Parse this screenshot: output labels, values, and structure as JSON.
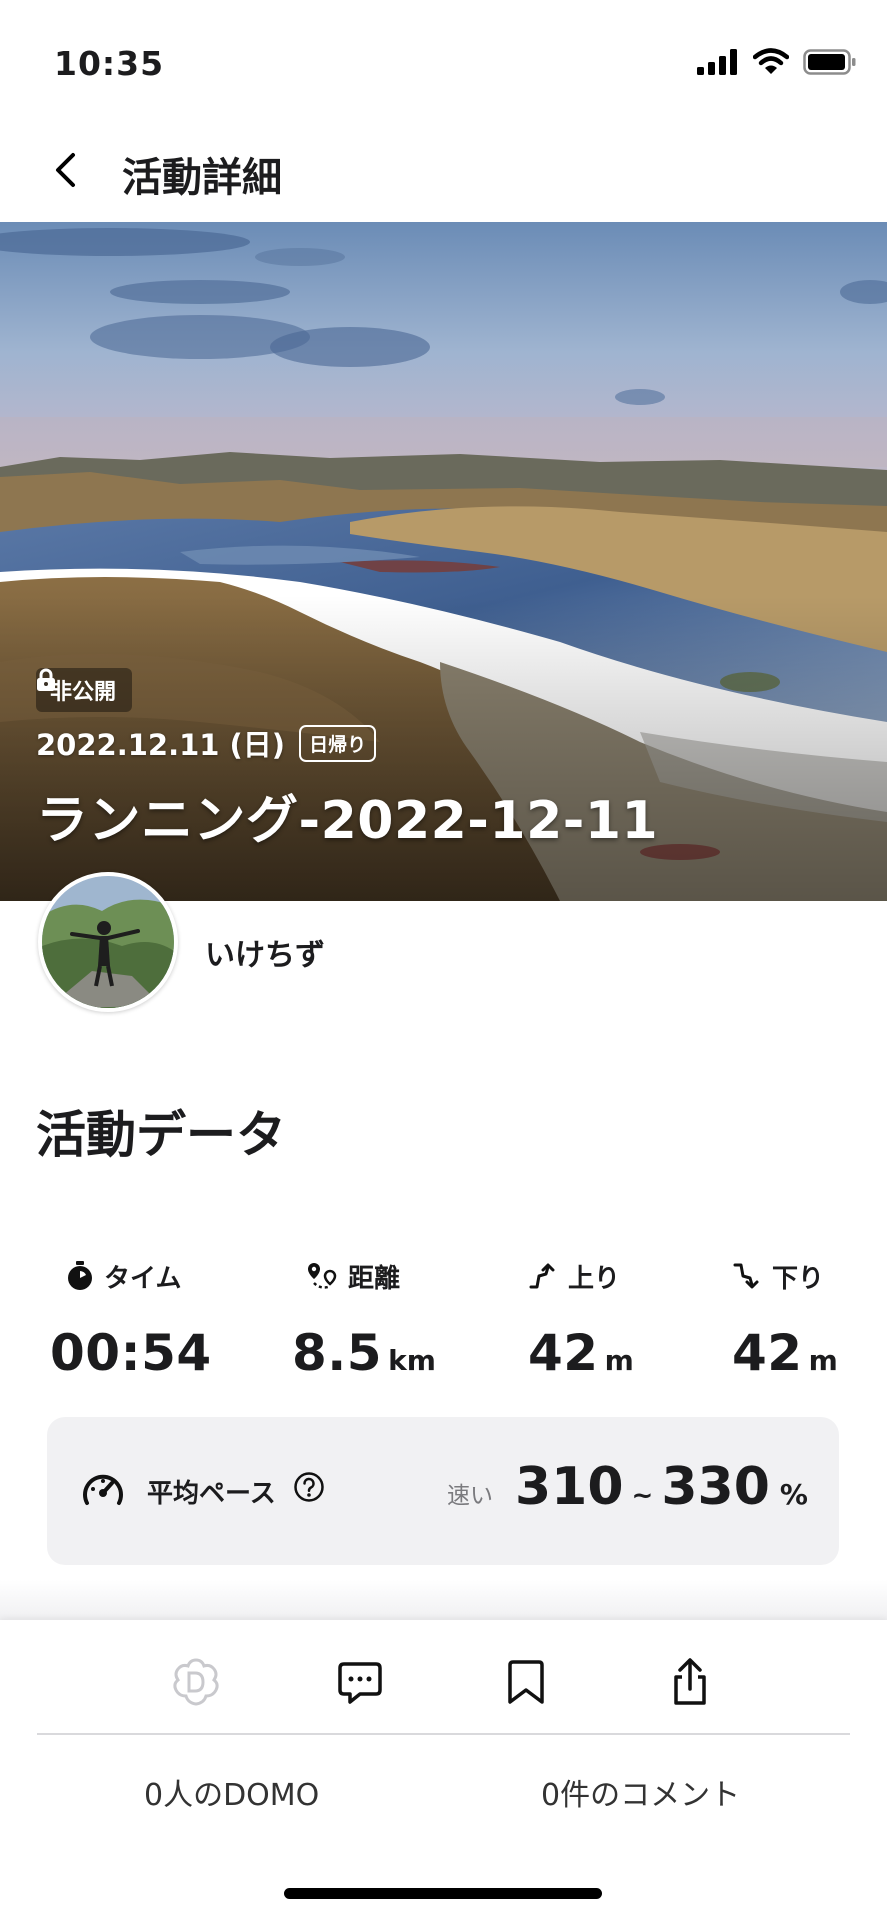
{
  "status_bar": {
    "time": "10:35"
  },
  "nav": {
    "title": "活動詳細"
  },
  "hero": {
    "privacy": "非公開",
    "date": "2022.12.11 (日)",
    "trip_type": "日帰り",
    "title": "ランニング-2022-12-11"
  },
  "user": {
    "name": "いけちず"
  },
  "section": {
    "title": "活動データ"
  },
  "stats": [
    {
      "icon": "stopwatch-icon",
      "label": "タイム",
      "value": "00:54",
      "unit": ""
    },
    {
      "icon": "route-pin-icon",
      "label": "距離",
      "value": "8.5",
      "unit": "km"
    },
    {
      "icon": "ascent-icon",
      "label": "上り",
      "value": "42",
      "unit": "m"
    },
    {
      "icon": "descent-icon",
      "label": "下り",
      "value": "42",
      "unit": "m"
    }
  ],
  "pace": {
    "label": "平均ペース",
    "speed_label": "速い",
    "min": "310",
    "separator": "~",
    "max": "330",
    "unit": "%"
  },
  "actions": {
    "icons": [
      "domo-icon",
      "comment-icon",
      "bookmark-icon",
      "share-icon"
    ],
    "domo_count_text": "0人のDOMO",
    "comment_count_text": "0件のコメント"
  }
}
